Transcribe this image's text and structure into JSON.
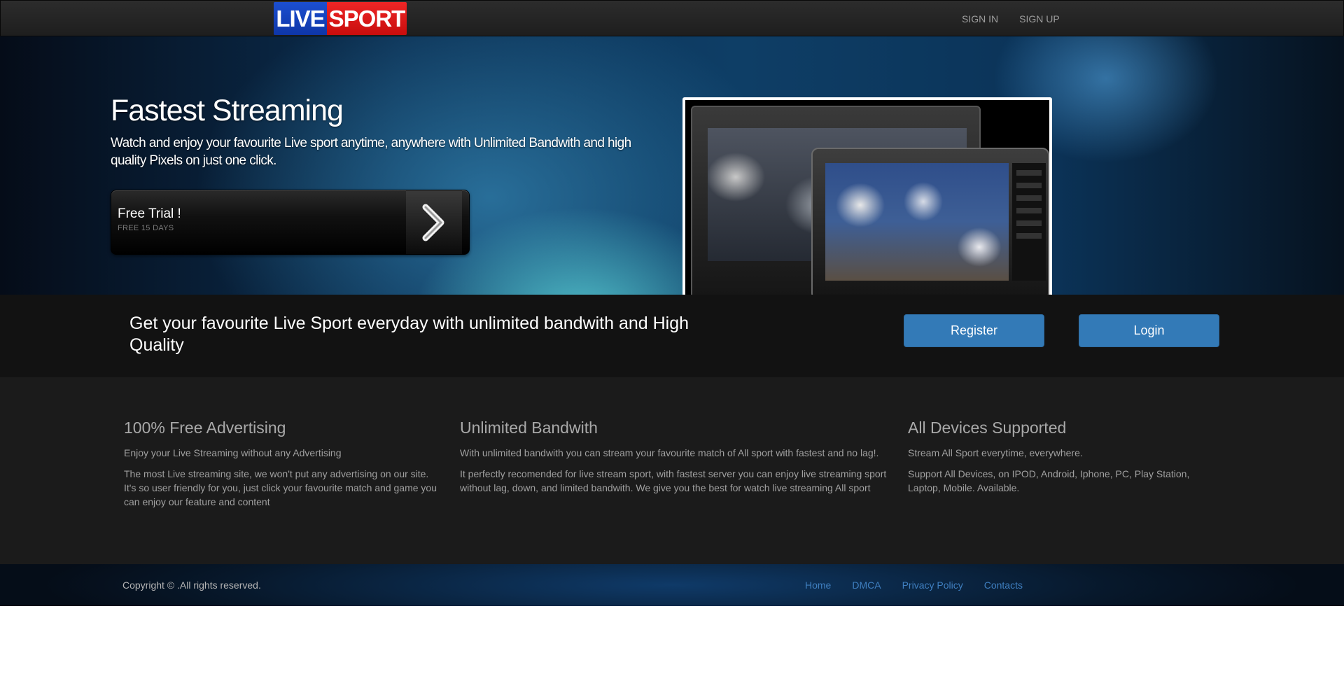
{
  "navbar": {
    "logo_live": "LIVE",
    "logo_sport": "SPORT",
    "links": [
      "SIGN IN",
      "SIGN UP"
    ]
  },
  "hero": {
    "title": "Fastest Streaming",
    "subtitle": "Watch and enjoy your favourite Live sport anytime, anywhere with Unlimited Bandwith and high quality Pixels on just one click.",
    "trial_title": "Free Trial !",
    "trial_sub": "FREE 15 DAYS",
    "carousel_active": 1,
    "carousel_count": 4
  },
  "cta": {
    "text": "Get your favourite Live Sport everyday with unlimited bandwith and High Quality",
    "register_label": "Register",
    "login_label": "Login"
  },
  "features": [
    {
      "title": "100% Free Advertising",
      "p1": "Enjoy your Live Streaming without any Advertising",
      "p2": "The most Live streaming site, we won't put any advertising on our site. It's so user friendly for you, just click your favourite match and game you can enjoy our feature and content"
    },
    {
      "title": "Unlimited Bandwith",
      "p1": "With unlimited bandwith you can stream your favourite match of All sport with fastest and no lag!.",
      "p2": "It perfectly recomended for live stream sport, with fastest server you can enjoy live streaming sport without lag, down, and limited bandwith. We give you the best for watch live streaming All sport"
    },
    {
      "title": "All Devices Supported",
      "p1": "Stream All Sport everytime, everywhere.",
      "p2": "Support All Devices, on IPOD, Android, Iphone, PC, Play Station, Laptop, Mobile. Available."
    }
  ],
  "footer": {
    "copyright": "Copyright © .All rights reserved.",
    "links": [
      "Home",
      "DMCA",
      "Privacy Policy",
      "Contacts"
    ]
  },
  "colors": {
    "primary_button": "#337ab7",
    "logo_blue": "#1c4fd0",
    "logo_red": "#ef2626",
    "footer_link": "#3f7fc0"
  }
}
